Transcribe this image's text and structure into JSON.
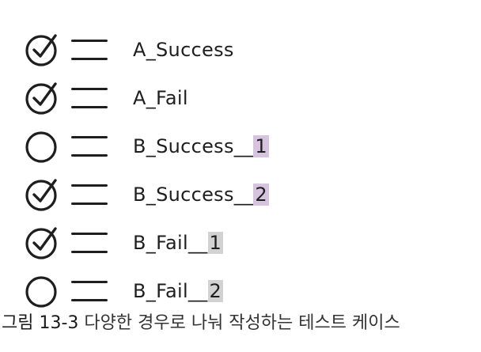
{
  "colors": {
    "highlight_purple": "#d6c4df",
    "highlight_gray": "#d2d2d2",
    "ink": "#1e1e1e"
  },
  "test_cases": [
    {
      "checked": true,
      "prefix": "A_Success",
      "suffix": "",
      "highlight": ""
    },
    {
      "checked": true,
      "prefix": "A_Fail",
      "suffix": "",
      "highlight": ""
    },
    {
      "checked": false,
      "prefix": "B_Success__",
      "suffix": "1",
      "highlight": "purple"
    },
    {
      "checked": true,
      "prefix": "B_Success__",
      "suffix": "2",
      "highlight": "purple"
    },
    {
      "checked": true,
      "prefix": "B_Fail__",
      "suffix": "1",
      "highlight": "gray"
    },
    {
      "checked": false,
      "prefix": "B_Fail__",
      "suffix": "2",
      "highlight": "gray"
    }
  ],
  "caption": {
    "figure_number": "그림 13-3",
    "text": "다양한 경우로 나눠 작성하는 테스트 케이스"
  }
}
